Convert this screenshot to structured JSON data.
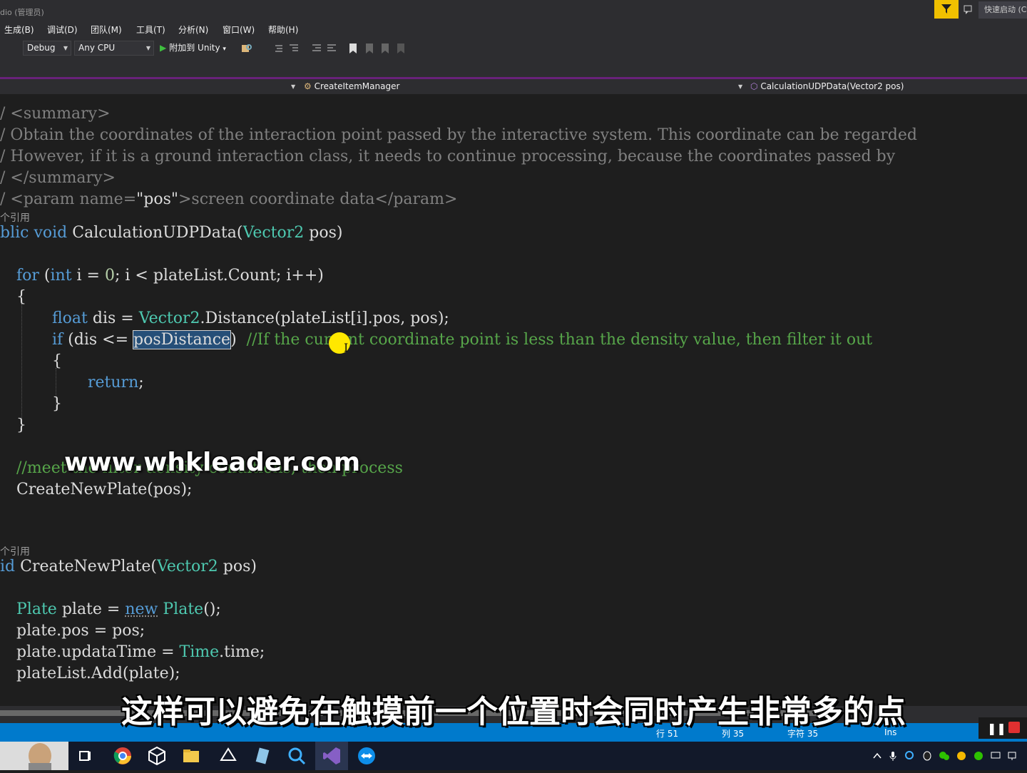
{
  "window": {
    "title": "dio (管理员)",
    "quick_launch": "快速启动 (Ctrl+Q)"
  },
  "menu": [
    "生成(B)",
    "调试(D)",
    "团队(M)",
    "工具(T)",
    "分析(N)",
    "窗口(W)",
    "帮助(H)"
  ],
  "toolbar": {
    "config": "Debug",
    "platform": "Any CPU",
    "run_label": "附加到 Unity",
    "run_dropdown": "▾"
  },
  "navbar": {
    "class_name": "CreateItemManager",
    "method_name": "CalculationUDPData(Vector2 pos)"
  },
  "codelens": {
    "ref1": "个引用",
    "ref2": "个引用"
  },
  "code": {
    "l1": "/ <summary>",
    "l2": "/ Obtain the coordinates of the interaction point passed by the interactive system. This coordinate can be regarded",
    "l3": "/ However, if it is a ground interaction class, it needs to continue processing, because the coordinates passed by",
    "l4": "/ </summary>",
    "l5a": "/ <param name=",
    "l5b": "\"pos\"",
    "l5c": ">screen coordinate data</param>",
    "sig1": "CalculationUDPData(",
    "sig1_type": "Vector2",
    "sig1_end": " pos)",
    "for_kw": "for",
    "for_rest1": " (",
    "for_int": "int",
    "for_rest2": " i = ",
    "for_zero": "0",
    "for_rest3": "; i < plateList.Count; i++)",
    "brace_open": "{",
    "float_kw": "float",
    "float_rest1": " dis = ",
    "float_type": "Vector2",
    "float_rest2": ".Distance(plateList[i].pos, pos);",
    "if_kw": "if",
    "if_rest": " (dis <= ",
    "if_sel": "posDistance",
    "if_close": ")  ",
    "if_comment": "//If the current coordinate point is less than the density value, then filter it out",
    "inner_open": "{",
    "return_kw": "return",
    "return_rest": ";",
    "inner_close": "}",
    "brace_close": "}",
    "meet_comment": "//meet the filter density conditions, then process",
    "create_call": "CreateNewPlate(pos);",
    "sig2_kw": "id",
    "sig2": " CreateNewPlate(",
    "sig2_type": "Vector2",
    "sig2_end": " pos)",
    "plate_type": "Plate",
    "plate_rest1": " plate = ",
    "plate_new": "new",
    "plate_type2": "Plate",
    "plate_rest2": "();",
    "pos_line": "plate.pos = pos;",
    "upd_rest1": "plate.updataTime = ",
    "upd_type": "Time",
    "upd_rest2": ".time;",
    "add_line": "plateList.Add(plate);",
    "public_kw": "blic void",
    "public_rest": " "
  },
  "watermark": "www.whkleader.com",
  "subtitle": "这样可以避免在触摸前一个位置时会同时产生非常多的点",
  "status": {
    "line": "行 51",
    "col": "列 35",
    "char": "字符 35",
    "mode": "Ins"
  },
  "colors": {
    "accent": "#007acc",
    "vs_purple": "#68217a",
    "keyword": "#569cd6",
    "type": "#4ec9b0",
    "comment": "#57a64a"
  },
  "taskbar_icons": [
    "task-view-icon",
    "chrome-icon",
    "unity-icon",
    "explorer-icon",
    "unity-hub-icon",
    "notes-icon",
    "search-app-icon",
    "visual-studio-icon",
    "teamviewer-icon"
  ]
}
